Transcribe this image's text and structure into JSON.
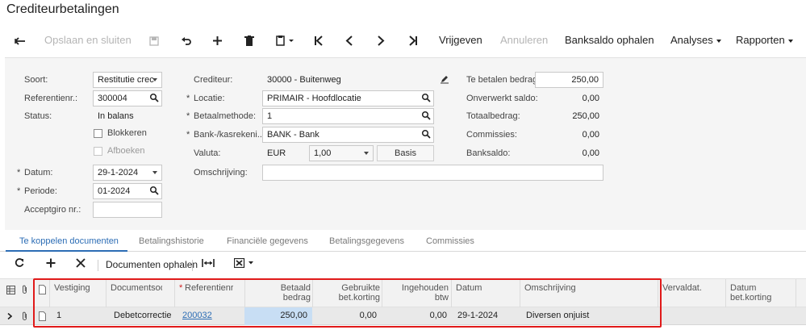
{
  "page": {
    "title": "Crediteurbetalingen"
  },
  "toolbar": {
    "save_close": "Opslaan en sluiten",
    "release": "Vrijgeven",
    "cancel": "Annuleren",
    "bank_balance": "Banksaldo ophalen",
    "analyses": "Analyses",
    "reports": "Rapporten"
  },
  "form": {
    "type_label": "Soort:",
    "type_value": "Restitutie crec",
    "ref_label": "Referentienr.:",
    "ref_value": "300004",
    "status_label": "Status:",
    "status_value": "In balans",
    "hold_label": "Blokkeren",
    "print_label": "Afboeken",
    "date_label": "Datum:",
    "date_value": "29-1-2024",
    "period_label": "Periode:",
    "period_value": "01-2024",
    "giro_label": "Acceptgiro nr.:",
    "giro_value": "",
    "vendor_label": "Crediteur:",
    "vendor_value": "30000 - Buitenweg",
    "location_label": "Locatie:",
    "location_value": "PRIMAIR - Hoofdlocatie",
    "method_label": "Betaalmethode:",
    "method_value": "1",
    "account_label": "Bank-/kasrekeni...",
    "account_value": "BANK - Bank",
    "currency_label": "Valuta:",
    "currency_value": "EUR",
    "rate_value": "1,00",
    "basis_button": "Basis",
    "desc_label": "Omschrijving:",
    "desc_value": "",
    "pay_amount_label": "Te betalen bedrag:",
    "pay_amount_value": "250,00",
    "unapplied_label": "Onverwerkt saldo:",
    "unapplied_value": "0,00",
    "total_label": "Totaalbedrag:",
    "total_value": "250,00",
    "fees_label": "Commissies:",
    "fees_value": "0,00",
    "bank_balance_label": "Banksaldo:",
    "bank_balance_value": "0,00"
  },
  "tabs": [
    {
      "label": "Te koppelen documenten",
      "active": true
    },
    {
      "label": "Betalingshistorie"
    },
    {
      "label": "Financiële gegevens"
    },
    {
      "label": "Betalingsgegevens"
    },
    {
      "label": "Commissies"
    }
  ],
  "grid_toolbar": {
    "load_docs": "Documenten ophalen"
  },
  "grid": {
    "headers": {
      "branch": "Vestiging",
      "doctype": "Documentsoo",
      "refnr": "Referentienr",
      "paid1": "Betaald",
      "paid2": "bedrag",
      "used1": "Gebruikte",
      "used2": "bet.korting",
      "withheld1": "Ingehouden",
      "withheld2": "btw",
      "date": "Datum",
      "desc": "Omschrijving",
      "due": "Vervaldat.",
      "disc_date1": "Datum",
      "disc_date2": "bet.korting"
    },
    "rows": [
      {
        "branch": "1",
        "doctype": "Debetcorrectie",
        "refnr": "200032",
        "paid": "250,00",
        "used": "0,00",
        "withheld": "0,00",
        "date": "29-1-2024",
        "desc": "Diversen onjuist"
      }
    ]
  },
  "colors": {
    "accent": "#2c6db5",
    "highlight_box": "#e01a1a",
    "selected_cell": "#c8def4"
  }
}
